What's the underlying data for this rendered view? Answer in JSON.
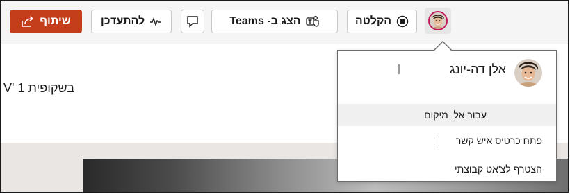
{
  "toolbar": {
    "share_label": "שיתוף",
    "catchup_label": "להתעדכן",
    "teams_label": "הצג ב- Teams",
    "record_label": "הקלטה"
  },
  "slide": {
    "label": "בשקופית 1 'V"
  },
  "profile_card": {
    "name": "אלן דה-יונג",
    "items": [
      {
        "label": "עבור אל  מיקום"
      },
      {
        "label": "פתח כרטיס איש קשר"
      },
      {
        "label": "הצטרף לצ'אט קבוצתי"
      }
    ]
  },
  "colors": {
    "share_button": "#c43e1c",
    "avatar_ring": "#c2185b",
    "toolbar_bg": "#f5f5f5"
  },
  "icons": {
    "share": "share-icon",
    "catchup": "activity-icon",
    "comment": "comment-icon",
    "teams": "teams-icon",
    "record": "record-icon"
  }
}
